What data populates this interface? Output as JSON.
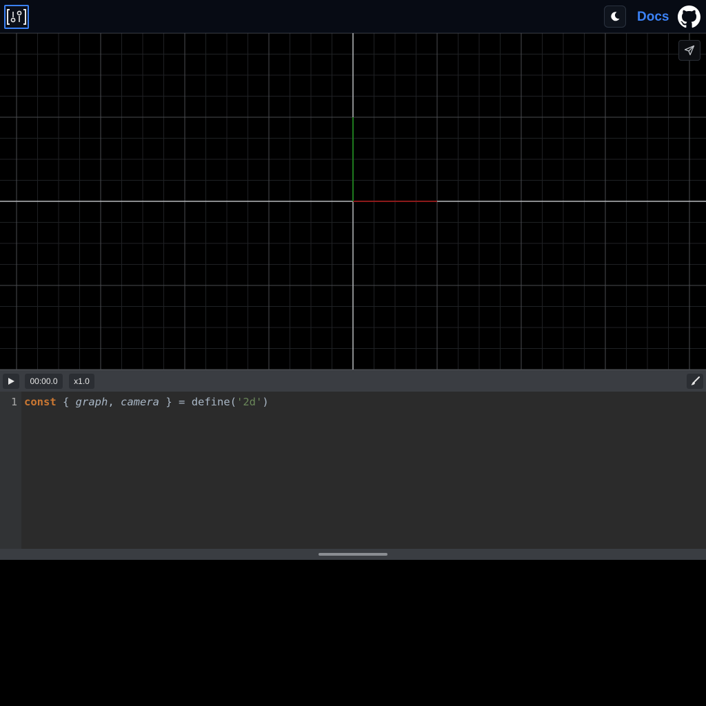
{
  "header": {
    "logo_icon": "brackets-logo-icon",
    "theme_toggle_icon": "moon-icon",
    "docs_label": "Docs",
    "github_icon": "github-icon",
    "accent_color": "#3b82f6"
  },
  "canvas": {
    "share_icon": "send-icon",
    "x_axis_color": "#8b1a1a",
    "y_axis_color": "#1e7a1e"
  },
  "controls": {
    "play_icon": "play-icon",
    "time": "00:00.0",
    "speed": "x1.0",
    "clear_icon": "brush-icon"
  },
  "editor": {
    "line_number": "1",
    "tokens": {
      "kw": "const",
      "open": " { ",
      "var1": "graph",
      "comma": ", ",
      "var2": "camera",
      "close": " } = ",
      "fn": "define(",
      "str": "'2d'",
      "end": ")"
    }
  }
}
